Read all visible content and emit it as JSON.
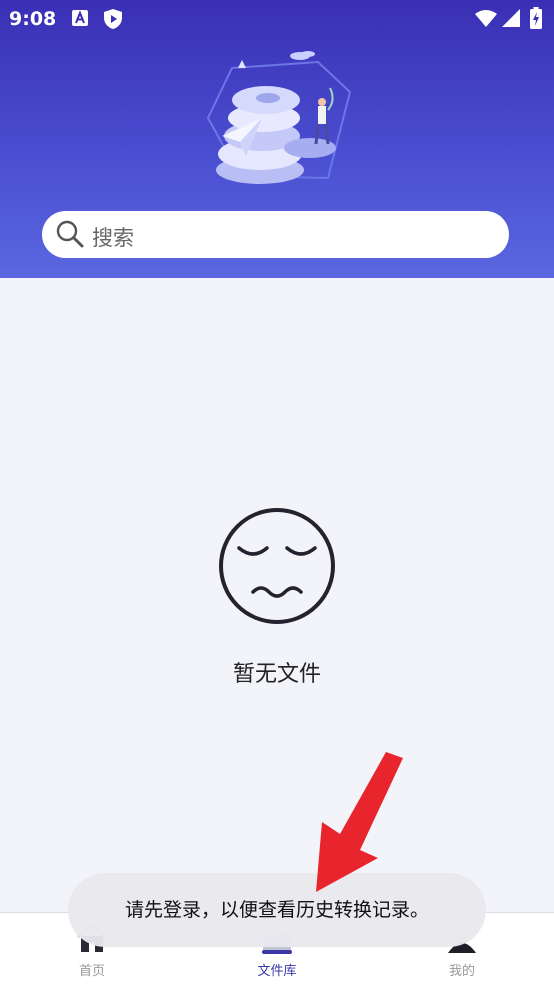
{
  "status_bar": {
    "time": "9:08",
    "icons": [
      "notification-a-icon",
      "shield-play-icon",
      "wifi-icon",
      "signal-icon",
      "battery-charging-icon"
    ]
  },
  "search": {
    "placeholder": "搜索"
  },
  "empty_state": {
    "icon": "sleepy-face-icon",
    "text": "暂无文件"
  },
  "bottom_nav": {
    "items": [
      {
        "label": "首页",
        "icon": "home-icon",
        "active": false
      },
      {
        "label": "文件库",
        "icon": "folder-icon",
        "active": true
      },
      {
        "label": "我的",
        "icon": "user-icon",
        "active": false
      }
    ]
  },
  "toast": {
    "message": "请先登录，以便查看历史转换记录。"
  },
  "colors": {
    "header_top": "#3a2fb4",
    "header_bottom": "#5a67e0",
    "accent": "#3a37a8",
    "annotation_arrow": "#e8252c"
  }
}
